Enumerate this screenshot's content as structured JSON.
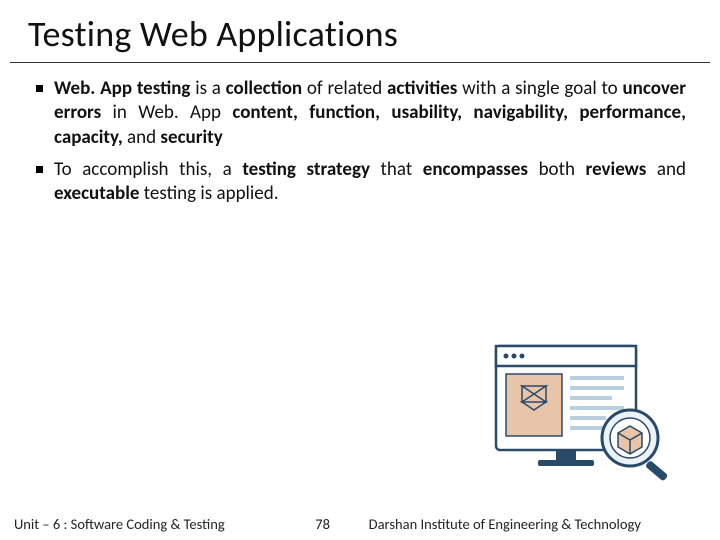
{
  "title": "Testing Web Applications",
  "bullets": [
    {
      "runs": [
        {
          "t": "Web. App testing",
          "b": true
        },
        {
          "t": " is a ",
          "b": false
        },
        {
          "t": "collection",
          "b": true
        },
        {
          "t": " of related ",
          "b": false
        },
        {
          "t": "activities",
          "b": true
        },
        {
          "t": " with a single goal to ",
          "b": false
        },
        {
          "t": "uncover errors",
          "b": true
        },
        {
          "t": " in Web. App ",
          "b": false
        },
        {
          "t": "content, function, usability, navigability, performance, capacity,",
          "b": true
        },
        {
          "t": " and ",
          "b": false
        },
        {
          "t": "security",
          "b": true
        }
      ]
    },
    {
      "runs": [
        {
          "t": "To accomplish this, a ",
          "b": false
        },
        {
          "t": "testing strategy",
          "b": true
        },
        {
          "t": " that ",
          "b": false
        },
        {
          "t": "encompasses",
          "b": true
        },
        {
          "t": " both ",
          "b": false
        },
        {
          "t": "reviews",
          "b": true
        },
        {
          "t": " and ",
          "b": false
        },
        {
          "t": "executable",
          "b": true
        },
        {
          "t": " testing is applied.",
          "b": false
        }
      ]
    }
  ],
  "footer": {
    "unit": "Unit – 6 : Software Coding & Testing",
    "page": "78",
    "institute": "Darshan Institute of Engineering & Technology"
  },
  "illustration_label": "web-testing-illustration"
}
